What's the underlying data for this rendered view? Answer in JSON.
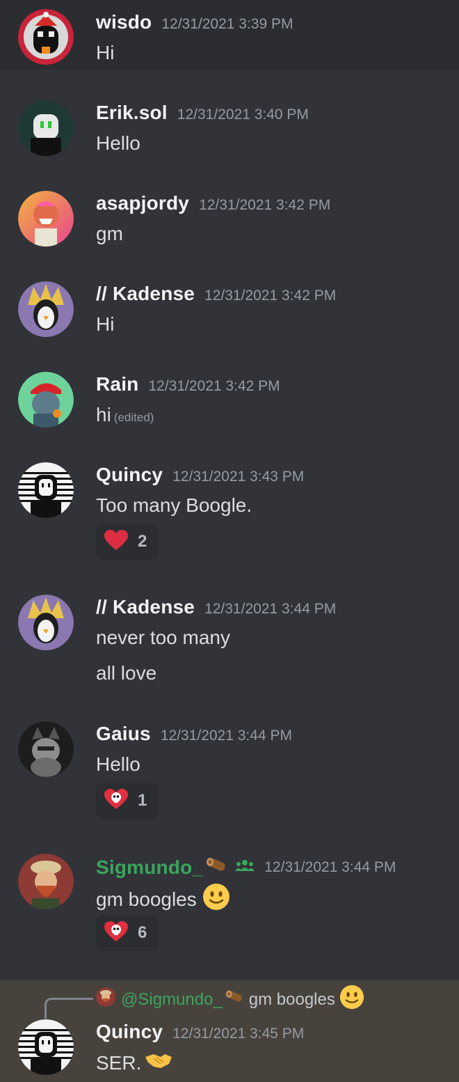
{
  "messages": [
    {
      "author": "wisdo",
      "timestamp": "12/31/2021 3:39 PM",
      "lines": [
        "Hi"
      ]
    },
    {
      "author": "Erik.sol",
      "timestamp": "12/31/2021 3:40 PM",
      "lines": [
        "Hello"
      ]
    },
    {
      "author": "asapjordy",
      "timestamp": "12/31/2021 3:42 PM",
      "lines": [
        "gm"
      ]
    },
    {
      "author": "// Kadense",
      "timestamp": "12/31/2021 3:42 PM",
      "lines": [
        "Hi"
      ]
    },
    {
      "author": "Rain",
      "timestamp": "12/31/2021 3:42 PM",
      "lines": [
        "hi"
      ],
      "edited_label": "(edited)"
    },
    {
      "author": "Quincy",
      "timestamp": "12/31/2021 3:43 PM",
      "lines": [
        "Too many Boogle."
      ],
      "reaction": {
        "icon": "heart-icon",
        "count": "2"
      }
    },
    {
      "author": "// Kadense",
      "timestamp": "12/31/2021 3:44 PM",
      "lines": [
        "never too many",
        "all love"
      ]
    },
    {
      "author": "Gaius",
      "timestamp": "12/31/2021 3:44 PM",
      "lines": [
        "Hello"
      ],
      "reaction": {
        "icon": "skull-heart-icon",
        "count": "1"
      }
    },
    {
      "author": "Sigmundo_",
      "timestamp": "12/31/2021 3:44 PM",
      "lines": [
        "gm boogles"
      ],
      "author_color": "#3ba55d",
      "reaction": {
        "icon": "skull-heart-icon",
        "count": "6"
      }
    },
    {
      "author": "Quincy",
      "timestamp": "12/31/2021 3:45 PM",
      "lines": [
        "SER."
      ],
      "reply": {
        "mention": "@Sigmundo_",
        "text": "gm boogles"
      }
    }
  ],
  "colors": {
    "background": "#313338",
    "hover": "#2b2d31",
    "reply_highlight": "#47433c",
    "green_name": "#3ba55d",
    "timestamp": "#949ba4"
  }
}
